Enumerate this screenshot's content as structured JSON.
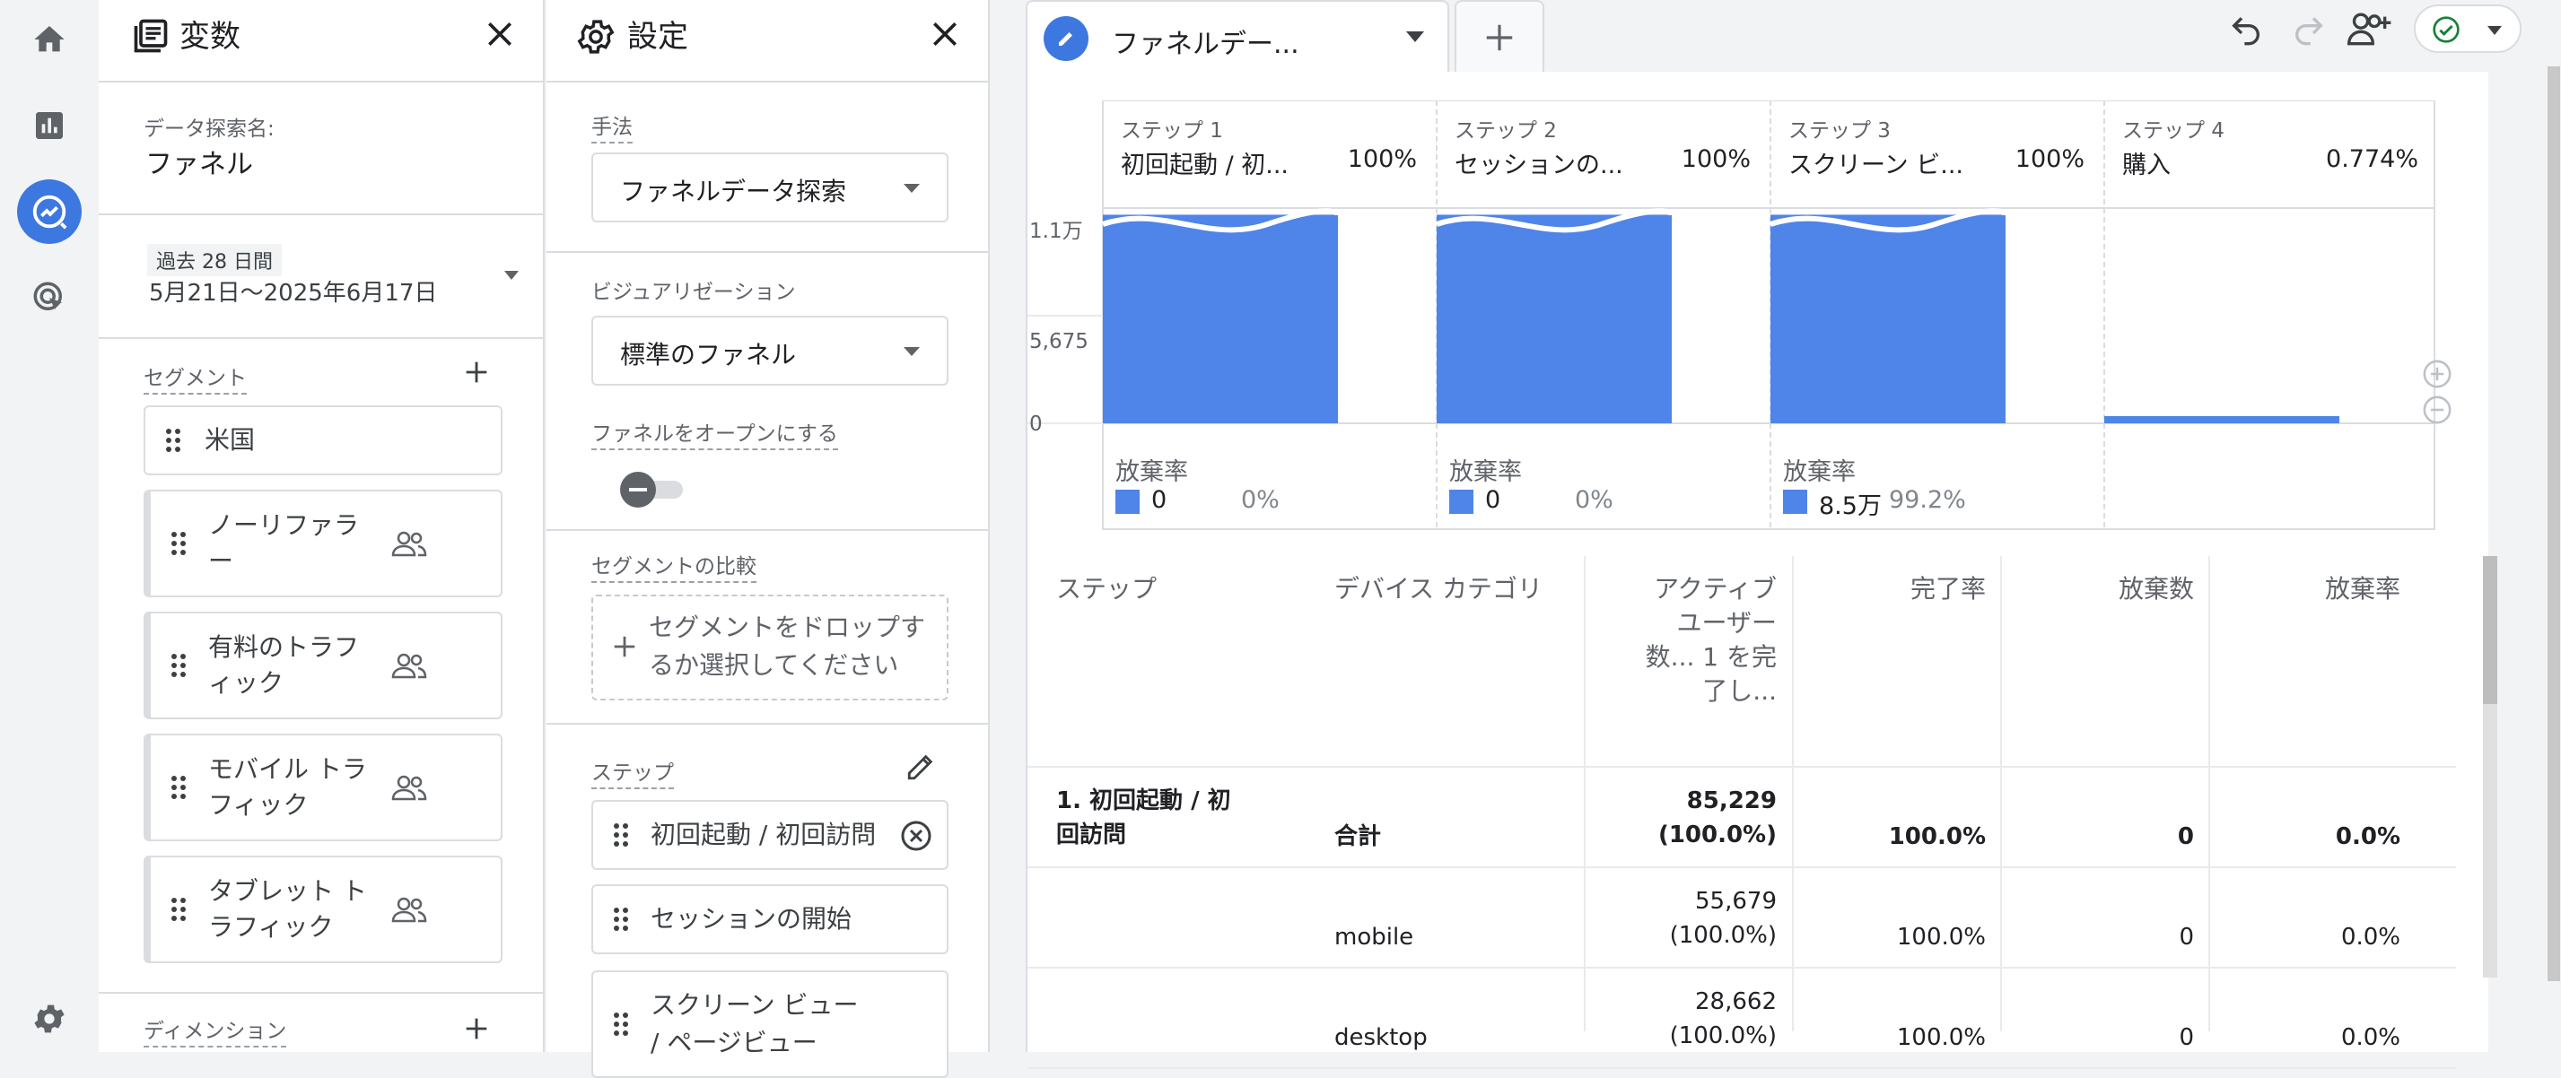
{
  "variables": {
    "title": "変数",
    "exploration_name_label": "データ探索名:",
    "exploration_name": "ファネル",
    "date_badge": "過去 28 日間",
    "date_range": "5月21日〜2025年6月17日",
    "segments_label": "セグメント",
    "segments": [
      {
        "label": "米国",
        "type": "country"
      },
      {
        "label": "ノーリファラー",
        "type": "users"
      },
      {
        "label": "有料のトラフィック",
        "type": "users"
      },
      {
        "label": "モバイル トラフィック",
        "type": "users"
      },
      {
        "label": "タブレット トラフィック",
        "type": "users"
      }
    ],
    "dimensions_label": "ディメンション"
  },
  "settings": {
    "title": "設定",
    "technique_label": "手法",
    "technique_value": "ファネルデータ探索",
    "visualization_label": "ビジュアリゼーション",
    "visualization_value": "標準のファネル",
    "open_funnel_label": "ファネルをオープンにする",
    "open_funnel_on": false,
    "segment_compare_label": "セグメントの比較",
    "segment_drop_text": "セグメントをドロップするか選択してください",
    "steps_label": "ステップ",
    "steps": [
      "初回起動 / 初回訪問",
      "セッションの開始",
      "スクリーン ビュー / ページビュー"
    ]
  },
  "tabs": [
    {
      "label": "ファネルデー..."
    }
  ],
  "chart_data": {
    "type": "bar",
    "title": "",
    "categories": [
      "初回起動 / 初...",
      "セッションの...",
      "スクリーン ビ...",
      "購入"
    ],
    "step_numbers": [
      "ステップ 1",
      "ステップ 2",
      "ステップ 3",
      "ステップ 4"
    ],
    "step_percents": [
      "100%",
      "100%",
      "100%",
      "0.774%"
    ],
    "values": [
      11000,
      11000,
      11000,
      85
    ],
    "truncated_top": [
      true,
      true,
      true,
      false
    ],
    "y_ticks": [
      "1.1万",
      "5,675",
      "0"
    ],
    "ylim": [
      0,
      11350
    ],
    "abandon_label": "放棄率",
    "abandon": [
      {
        "value": "0",
        "pct": "0%"
      },
      {
        "value": "0",
        "pct": "0%"
      },
      {
        "value": "8.5万",
        "pct": "99.2%"
      }
    ],
    "bar_color": "#4f84e8"
  },
  "table": {
    "headers": [
      "ステップ",
      "デバイス カテゴリ",
      "アクティブ ユーザー数... 1 を完了し...",
      "完了率",
      "放棄数",
      "放棄率"
    ],
    "rows": [
      {
        "step": "1. 初回起動 / 初回訪問",
        "device": "合計",
        "users": "85,229",
        "users_pct": "(100.0%)",
        "completion": "100.0%",
        "abandon_count": "0",
        "abandon_rate": "0.0%",
        "bold": true
      },
      {
        "step": "",
        "device": "mobile",
        "users": "55,679",
        "users_pct": "(100.0%)",
        "completion": "100.0%",
        "abandon_count": "0",
        "abandon_rate": "0.0%",
        "bold": false
      },
      {
        "step": "",
        "device": "desktop",
        "users": "28,662",
        "users_pct": "(100.0%)",
        "completion": "100.0%",
        "abandon_count": "0",
        "abandon_rate": "0.0%",
        "bold": false
      }
    ]
  },
  "colors": {
    "accent": "#3c78e0",
    "bar": "#4f84e8",
    "status_ok": "#188038"
  }
}
